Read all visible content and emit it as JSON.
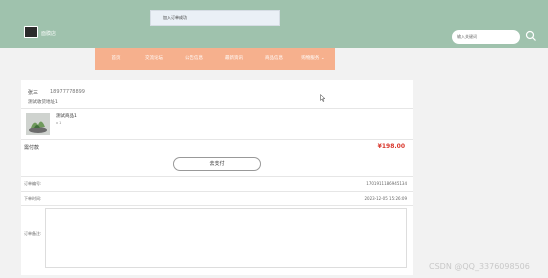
{
  "toast": {
    "text": "加入订单成功"
  },
  "header": {
    "site_name": "面膜店",
    "logo_icon": "flag-logo-icon"
  },
  "search": {
    "placeholder": "输入关键词",
    "icon": "search-icon"
  },
  "nav": {
    "items": [
      "首页",
      "交流论坛",
      "公告信息",
      "最新资讯",
      "商品信息",
      "购物服务 ⌄"
    ]
  },
  "receiver": {
    "name": "张三",
    "phone": "18977778899",
    "address": "测试收货地址1"
  },
  "product": {
    "name": "测试商品1",
    "qty": "x 1"
  },
  "order": {
    "total_label": "需付款",
    "total_value": "¥198.00",
    "pay_label": "去支付",
    "order_no_label": "订单编号:",
    "order_no_value": "1701911186945134",
    "time_label": "下单时间:",
    "time_value": "2023-12-05 15:26:09",
    "remark_label": "订单备注:"
  },
  "watermark": "CSDN @QQ_3376098506"
}
